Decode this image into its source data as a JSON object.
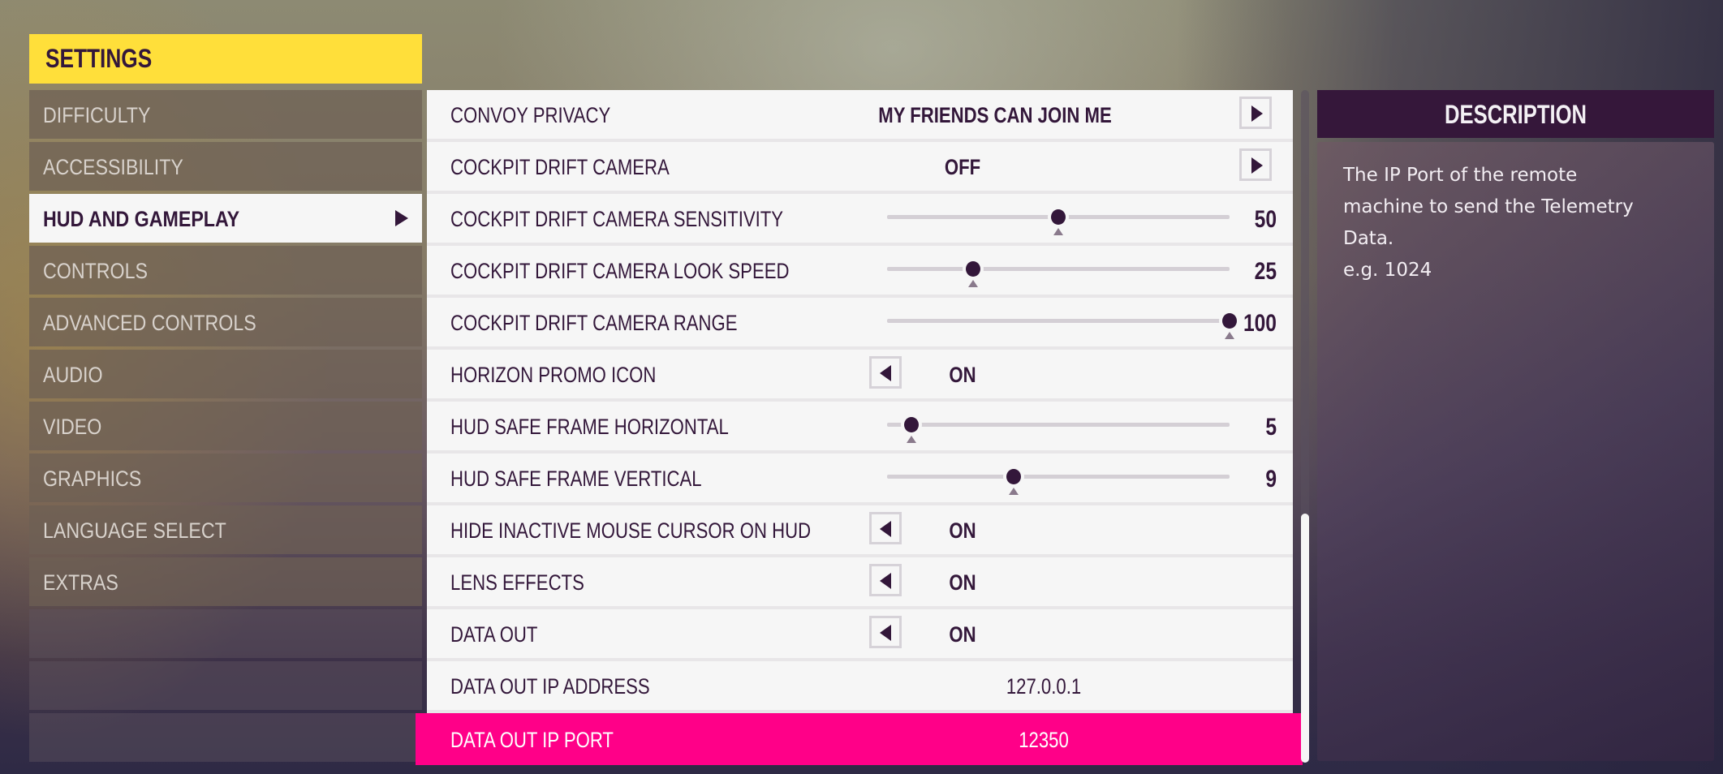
{
  "header": {
    "title": "SETTINGS"
  },
  "sidebar": {
    "items": [
      {
        "label": "DIFFICULTY",
        "active": false
      },
      {
        "label": "ACCESSIBILITY",
        "active": false
      },
      {
        "label": "HUD AND GAMEPLAY",
        "active": true
      },
      {
        "label": "CONTROLS",
        "active": false
      },
      {
        "label": "ADVANCED CONTROLS",
        "active": false
      },
      {
        "label": "AUDIO",
        "active": false
      },
      {
        "label": "VIDEO",
        "active": false
      },
      {
        "label": "GRAPHICS",
        "active": false
      },
      {
        "label": "LANGUAGE SELECT",
        "active": false
      },
      {
        "label": "EXTRAS",
        "active": false
      }
    ],
    "empty_slots": 3
  },
  "settings": {
    "rows": [
      {
        "label": "CONVOY PRIVACY",
        "type": "selector-right",
        "value": "MY FRIENDS CAN JOIN ME"
      },
      {
        "label": "COCKPIT DRIFT CAMERA",
        "type": "selector-right",
        "value": "OFF"
      },
      {
        "label": "COCKPIT DRIFT CAMERA SENSITIVITY",
        "type": "slider",
        "value": "50",
        "fraction": 0.5
      },
      {
        "label": "COCKPIT DRIFT CAMERA LOOK SPEED",
        "type": "slider",
        "value": "25",
        "fraction": 0.25
      },
      {
        "label": "COCKPIT DRIFT CAMERA RANGE",
        "type": "slider",
        "value": "100",
        "fraction": 1.0
      },
      {
        "label": "HORIZON PROMO ICON",
        "type": "selector-left",
        "value": "ON"
      },
      {
        "label": "HUD SAFE FRAME HORIZONTAL",
        "type": "slider",
        "value": "5",
        "fraction": 0.07
      },
      {
        "label": "HUD SAFE FRAME VERTICAL",
        "type": "slider",
        "value": "9",
        "fraction": 0.37
      },
      {
        "label": "HIDE INACTIVE MOUSE CURSOR ON HUD",
        "type": "selector-left",
        "value": "ON"
      },
      {
        "label": "LENS EFFECTS",
        "type": "selector-left",
        "value": "ON"
      },
      {
        "label": "DATA OUT",
        "type": "selector-left",
        "value": "ON"
      },
      {
        "label": "DATA OUT IP ADDRESS",
        "type": "text",
        "value": "127.0.0.1"
      },
      {
        "label": "DATA OUT IP PORT",
        "type": "text",
        "value": "12350",
        "highlighted": true
      }
    ]
  },
  "scrollbar": {
    "thumb_start": 0.63,
    "thumb_end": 1.0
  },
  "description": {
    "title": "DESCRIPTION",
    "text": "The IP Port of the remote\nmachine to send the Telemetry\nData.\ne.g. 1024"
  },
  "colors": {
    "header_yellow": "#ffdf3a",
    "dark_purple": "#33173a",
    "highlight_pink": "#ff0088",
    "row_bg": "#f6f6f6"
  }
}
